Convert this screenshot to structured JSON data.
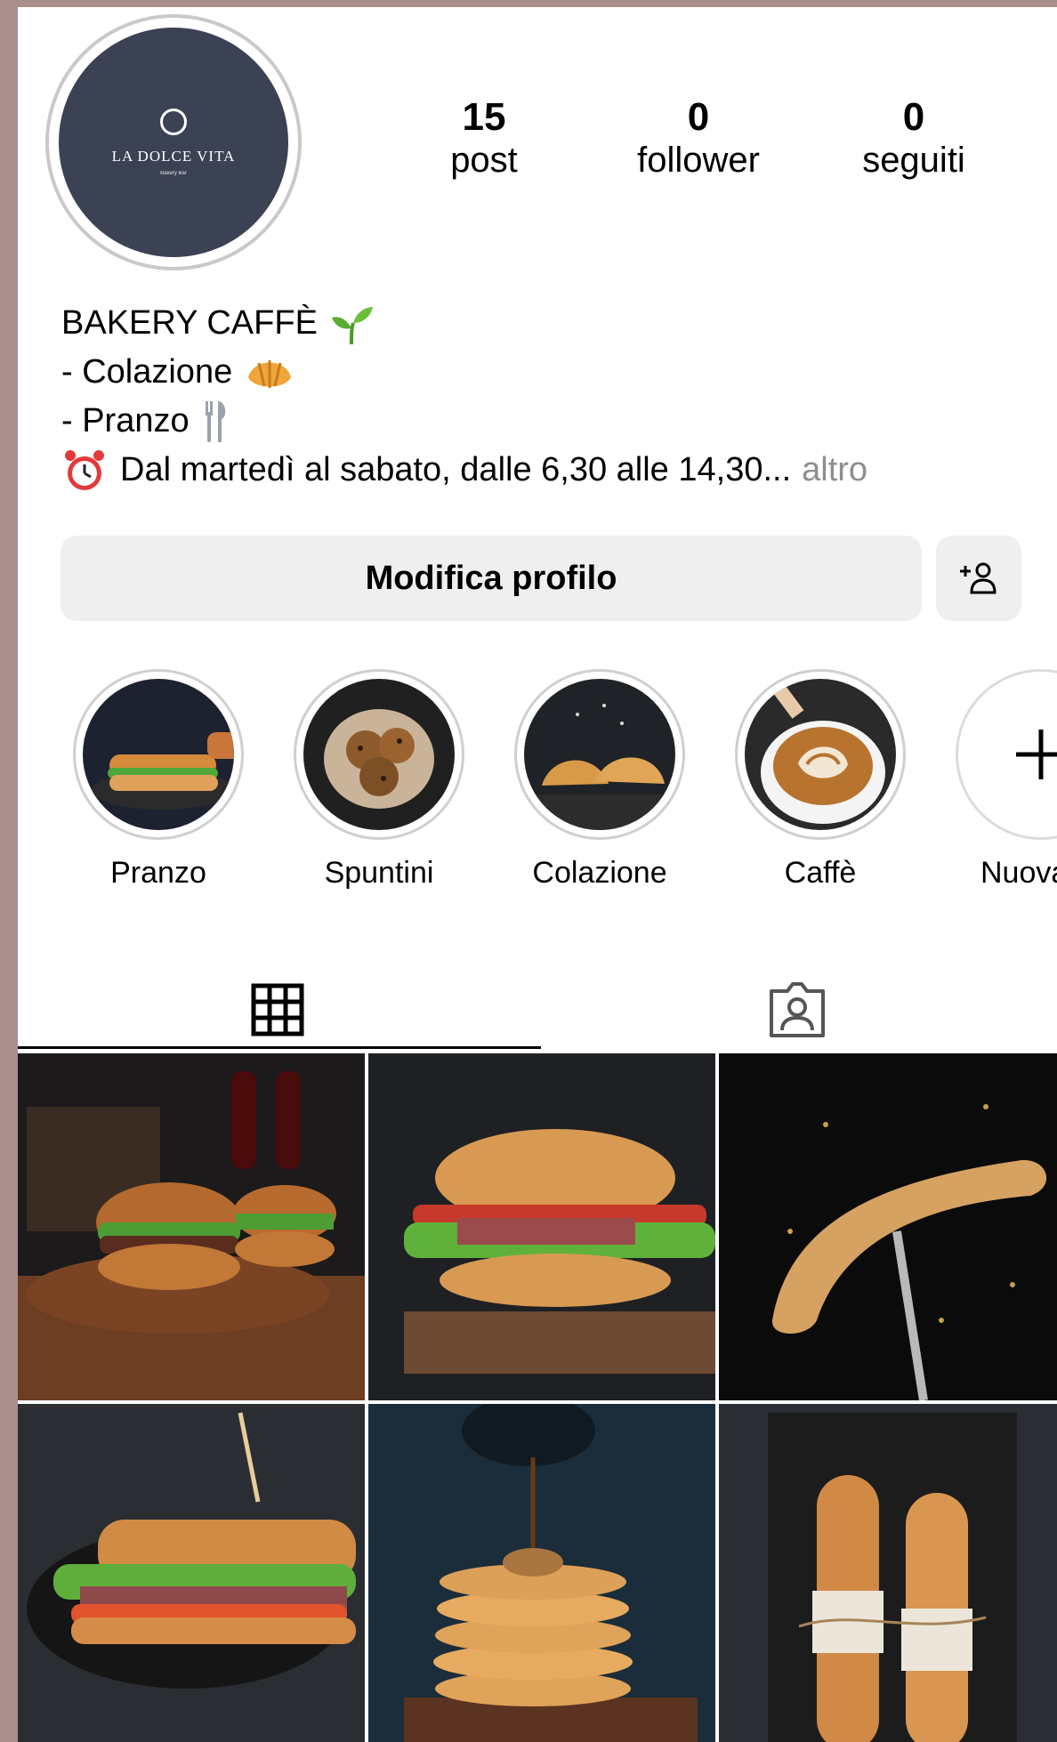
{
  "profile": {
    "logo_name": "LA DOLCE VITA",
    "logo_sub": "Bakery Bar",
    "stats": [
      {
        "value": "15",
        "label": "post"
      },
      {
        "value": "0",
        "label": "follower"
      },
      {
        "value": "0",
        "label": "seguiti"
      }
    ]
  },
  "bio": {
    "line1": "BAKERY CAFFÈ",
    "line2": "- Colazione",
    "line3": "- Pranzo",
    "line4": "Dal martedì al sabato, dalle 6,30 alle 14,30...",
    "more": "altro"
  },
  "actions": {
    "edit_profile": "Modifica profilo"
  },
  "highlights": [
    {
      "label": "Pranzo"
    },
    {
      "label": "Spuntini"
    },
    {
      "label": "Colazione"
    },
    {
      "label": "Caffè"
    },
    {
      "label": "Nuova"
    }
  ],
  "icons": {
    "grid_tab": "grid-icon",
    "tagged_tab": "tagged-person-icon",
    "add_person": "add-person-icon",
    "plus": "plus-icon"
  },
  "colors": {
    "avatar_bg": "#3b4254",
    "button_bg": "#efefef",
    "muted_text": "#8e8e8e",
    "frame_bg": "#aa8f8d"
  }
}
